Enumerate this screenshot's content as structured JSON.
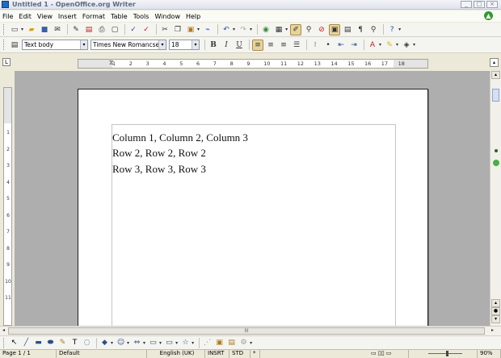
{
  "window": {
    "title": "Untitled 1 - OpenOffice.org Writer",
    "controls": [
      "_",
      "□",
      "×"
    ]
  },
  "menu": [
    {
      "label": "File"
    },
    {
      "label": "Edit"
    },
    {
      "label": "View"
    },
    {
      "label": "Insert"
    },
    {
      "label": "Format"
    },
    {
      "label": "Table"
    },
    {
      "label": "Tools"
    },
    {
      "label": "Window"
    },
    {
      "label": "Help"
    }
  ],
  "standard_toolbar": {
    "icons": [
      "new-document-icon",
      "open-icon",
      "save-icon",
      "email-icon",
      "edit-file-icon",
      "export-pdf-icon",
      "print-icon",
      "page-preview-icon",
      "spellcheck-icon",
      "autospellcheck-icon",
      "cut-icon",
      "copy-icon",
      "paste-icon",
      "clone-formatting-icon",
      "undo-icon",
      "redo-icon",
      "hyperlink-icon",
      "table-icon",
      "show-draw-functions-icon",
      "find-replace-icon",
      "navigator-icon",
      "gallery-icon",
      "data-sources-icon",
      "nonprinting-characters-icon",
      "zoom-icon",
      "help-icon"
    ]
  },
  "formatting_toolbar": {
    "paragraph_style": "Text body",
    "font_name": "Times New Romancserif",
    "font_size": "18",
    "bold": "B",
    "italic": "I",
    "underline": "U",
    "icons": [
      "styles-icon",
      "align-left-icon",
      "align-center-icon",
      "align-right-icon",
      "justify-icon",
      "numbering-icon",
      "bullets-icon",
      "decrease-indent-icon",
      "increase-indent-icon",
      "font-color-icon",
      "highlighting-icon",
      "background-color-icon"
    ]
  },
  "ruler": {
    "ticks": [
      "1",
      "2",
      "3",
      "4",
      "5",
      "6",
      "7",
      "8",
      "9",
      "10",
      "11",
      "12",
      "13",
      "14",
      "15",
      "16",
      "17",
      "18"
    ],
    "vticks": [
      "1",
      "2",
      "3",
      "4",
      "5",
      "6",
      "7",
      "8",
      "9",
      "10",
      "11"
    ]
  },
  "document": {
    "lines": [
      "Column 1, Column 2, Column 3",
      "Row 2, Row 2, Row 2",
      "Row 3, Row 3, Row 3"
    ]
  },
  "hscroll": {
    "label": "III"
  },
  "drawing_toolbar": {
    "icons": [
      "select-icon",
      "line-icon",
      "rectangle-icon",
      "ellipse-icon",
      "freeform-icon",
      "text-icon",
      "callouts-icon",
      "basic-shapes-icon",
      "symbol-shapes-icon",
      "block-arrows-icon",
      "flowcharts-icon",
      "callout-shapes-icon",
      "stars-icon",
      "points-icon",
      "fontwork-icon",
      "from-file-icon",
      "extrusion-icon"
    ]
  },
  "status": {
    "page": "Page 1 / 1",
    "style": "Default",
    "language": "English (UK)",
    "insert_mode": "INSRT",
    "selection_mode": "STD",
    "modified": "*",
    "zoom": "90%"
  }
}
